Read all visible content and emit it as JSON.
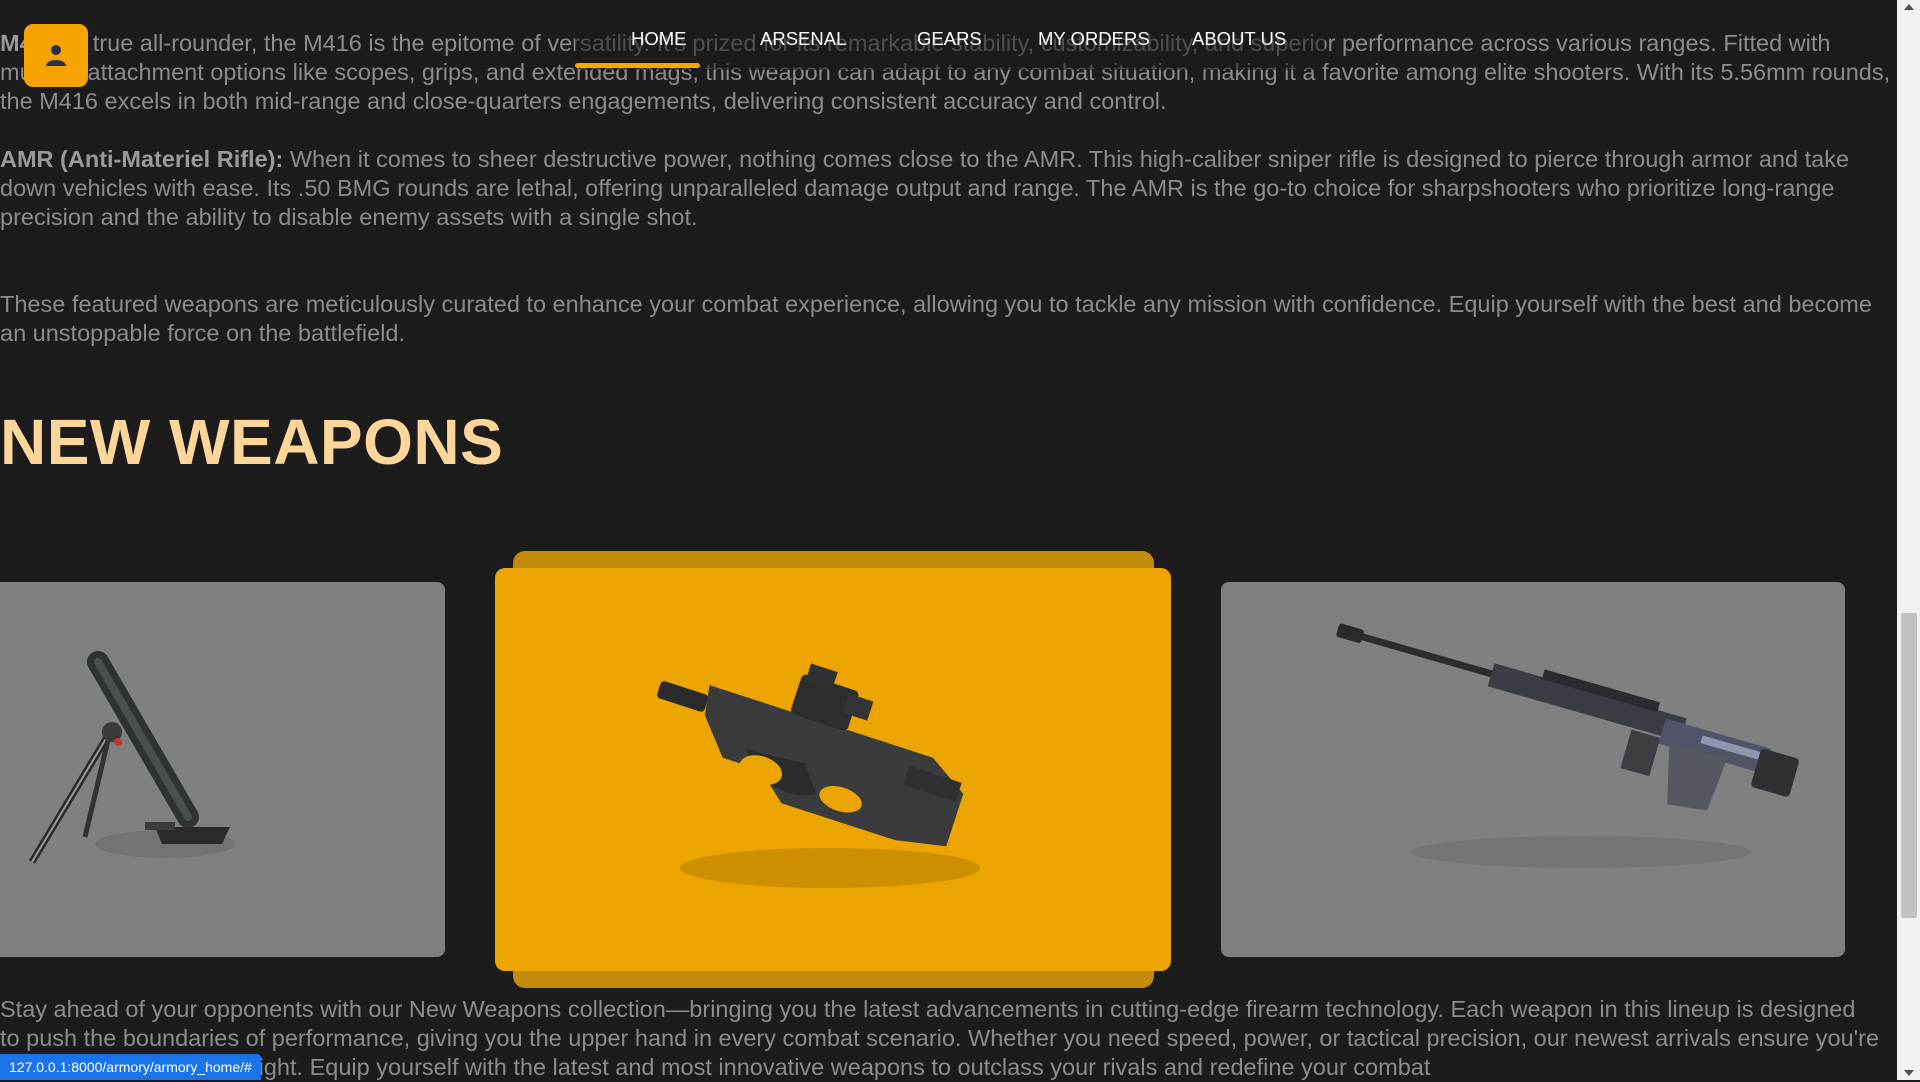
{
  "nav": {
    "items": [
      {
        "label": "HOME"
      },
      {
        "label": "ARSENAL"
      },
      {
        "label": "GEARS"
      },
      {
        "label": "MY ORDERS"
      },
      {
        "label": "ABOUT US"
      }
    ],
    "active": "HOME"
  },
  "paragraphs": {
    "m416_name": "M416:",
    "m416_text": " A true all-rounder, the M416 is the epitome of versatility. It's prized for its remarkable stability, customizability, and superior performance across various ranges. Fitted with multiple attachment options like scopes, grips, and extended mags, this weapon can adapt to any combat situation, making it a favorite among elite shooters. With its 5.56mm rounds, the M416 excels in both mid-range and close-quarters engagements, delivering consistent accuracy and control.",
    "amr_name": "AMR (Anti-Materiel Rifle):",
    "amr_text": " When it comes to sheer destructive power, nothing comes close to the AMR. This high-caliber sniper rifle is designed to pierce through armor and take down vehicles with ease. Its .50 BMG rounds are lethal, offering unparalleled damage output and range. The AMR is the go-to choice for sharpshooters who prioritize long-range precision and the ability to disable enemy assets with a single shot.",
    "featured_summary": "These featured weapons are meticulously curated to enhance your combat experience, allowing you to tackle any mission with confidence. Equip yourself with the best and become an unstoppable force on the battlefield.",
    "new_weapons_intro": "Stay ahead of your opponents with our New Weapons collection—bringing you the latest advancements in cutting-edge firearm technology. Each weapon in this lineup is designed to push the boundaries of performance, giving you the upper hand in every combat scenario. Whether you need speed, power, or tactical precision, our newest arrivals ensure you're always prepared for the fight. Equip yourself with the latest and most innovative weapons to outclass your rivals and redefine your combat"
  },
  "section": {
    "title": "NEW WEAPONS"
  },
  "carousel": {
    "cards": [
      {
        "icon": "mortar-icon"
      },
      {
        "icon": "p90-smg-icon"
      },
      {
        "icon": "sniper-rifle-icon"
      }
    ],
    "active_index": 1,
    "colors": {
      "card": "#808080",
      "active": "#eba400"
    }
  },
  "status_bar": {
    "url": "127.0.0.1:8000/armory/armory_home/#"
  },
  "colors": {
    "accent": "#f2a900",
    "heading": "#ffd699",
    "background": "#1c1c1c"
  }
}
